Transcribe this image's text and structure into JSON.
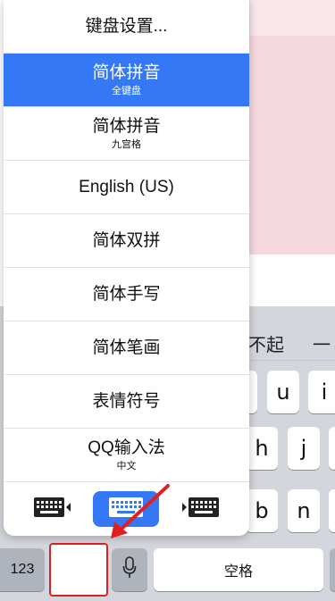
{
  "menu": {
    "items": [
      {
        "label": "键盘设置...",
        "sub": ""
      },
      {
        "label": "简体拼音",
        "sub": "全键盘",
        "selected": true
      },
      {
        "label": "简体拼音",
        "sub": "九宫格"
      },
      {
        "label": "English (US)",
        "sub": ""
      },
      {
        "label": "简体双拼",
        "sub": ""
      },
      {
        "label": "简体手写",
        "sub": ""
      },
      {
        "label": "简体笔画",
        "sub": ""
      },
      {
        "label": "表情符号",
        "sub": ""
      },
      {
        "label": "QQ输入法",
        "sub": "中文"
      }
    ],
    "bottom_icons": [
      "keyboard-left-icon",
      "keyboard-full-icon",
      "keyboard-right-icon"
    ]
  },
  "candidates": [
    "不起",
    "一"
  ],
  "keys": {
    "row1": [
      "u",
      "i"
    ],
    "row2": [
      "h",
      "j"
    ],
    "row3": [
      "b",
      "n"
    ],
    "bottom": {
      "num_label": "123",
      "space_label": "空格"
    }
  },
  "colors": {
    "accent": "#3478f6",
    "highlight": "#e02020",
    "keyboard_bg": "#d3d6dc"
  }
}
